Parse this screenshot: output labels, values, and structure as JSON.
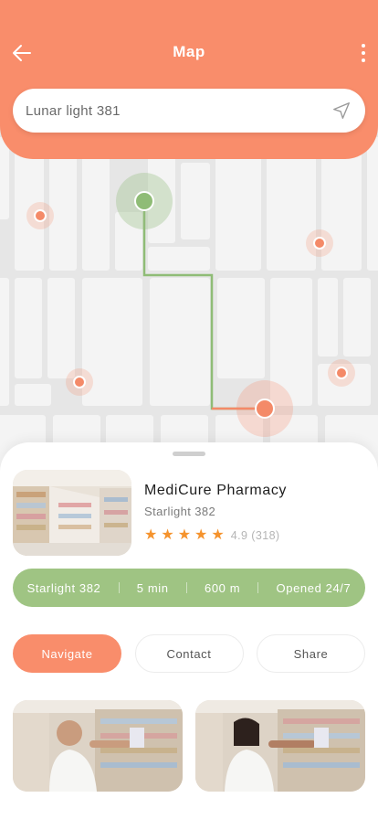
{
  "header": {
    "title": "Map",
    "search_value": "Lunar light 381",
    "back_icon": "arrow-left-icon",
    "more_icon": "more-vertical-icon",
    "search_icon": "navigation-arrow-icon"
  },
  "colors": {
    "accent": "#f98d6b",
    "route": "#8fbc76",
    "info_bar": "#9fc483",
    "star": "#f5932d"
  },
  "pharmacy": {
    "name": "MediCure Pharmacy",
    "address": "Starlight 382",
    "rating": "4.9",
    "reviews": "(318)",
    "stars": 5
  },
  "info": {
    "street": "Starlight 382",
    "time": "5 min",
    "distance": "600 m",
    "hours": "Opened 24/7"
  },
  "actions": {
    "navigate": "Navigate",
    "contact": "Contact",
    "share": "Share"
  }
}
